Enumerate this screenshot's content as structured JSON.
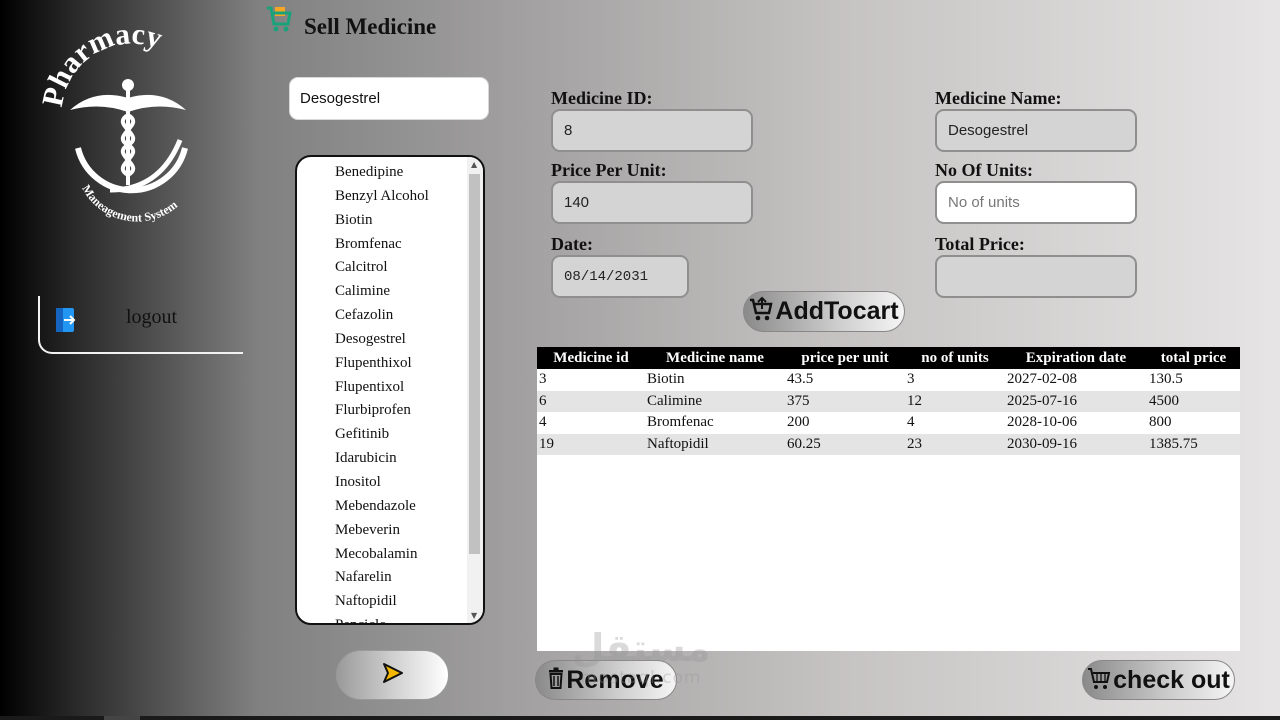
{
  "sidebar": {
    "logo_text": "Pharmacy",
    "logo_subtext": "Maneagement System",
    "logout_label": "logout",
    "logout_icon": "logout-icon"
  },
  "header": {
    "title": "Sell Medicine",
    "icon": "shopping-cart-icon"
  },
  "search": {
    "value": "Desogestrel"
  },
  "medicine_list": [
    "Benedipine",
    "Benzyl Alcohol",
    "Biotin",
    "Bromfenac",
    "Calcitrol",
    "Calimine",
    "Cefazolin",
    "Desogestrel",
    "Flupenthixol",
    "Flupentixol",
    "Flurbiprofen",
    "Gefitinib",
    "Idarubicin",
    "Inositol",
    "Mebendazole",
    "Mebeverin",
    "Mecobalamin",
    "Nafarelin",
    "Naftopidil",
    "Penciclo"
  ],
  "form": {
    "medicine_id_label": "Medicine ID:",
    "medicine_id_value": "8",
    "medicine_name_label": "Medicine Name:",
    "medicine_name_value": "Desogestrel",
    "price_label": "Price Per Unit:",
    "price_value": "140",
    "units_label": "No Of Units:",
    "units_placeholder": "No of units",
    "date_label": "Date:",
    "date_value": "08/14/2031",
    "total_label": "Total Price:",
    "total_value": ""
  },
  "buttons": {
    "add_to_cart": "AddTocart",
    "remove": "Remove",
    "checkout": "check out"
  },
  "cart_table": {
    "columns": [
      "Medicine id",
      "Medicine name",
      "price per unit",
      "no of units",
      "Expiration date",
      "total price"
    ],
    "rows": [
      [
        "3",
        "Biotin",
        "43.5",
        "3",
        "2027-02-08",
        "130.5"
      ],
      [
        "6",
        "Calimine",
        "375",
        "12",
        "2025-07-16",
        "4500"
      ],
      [
        "4",
        "Bromfenac",
        "200",
        "4",
        "2028-10-06",
        "800"
      ],
      [
        "19",
        "Naftopidil",
        "60.25",
        "23",
        "2030-09-16",
        "1385.75"
      ]
    ]
  },
  "watermark": {
    "arabic": "مستقل",
    "latin": "mostaql.com"
  },
  "colors": {
    "header_row": "#000000",
    "cart_icon_green": "#1aa37a",
    "cart_icon_orange": "#f5a623",
    "logout_icon_blue": "#2196f3",
    "send_arrow_fill": "#f5b800"
  }
}
